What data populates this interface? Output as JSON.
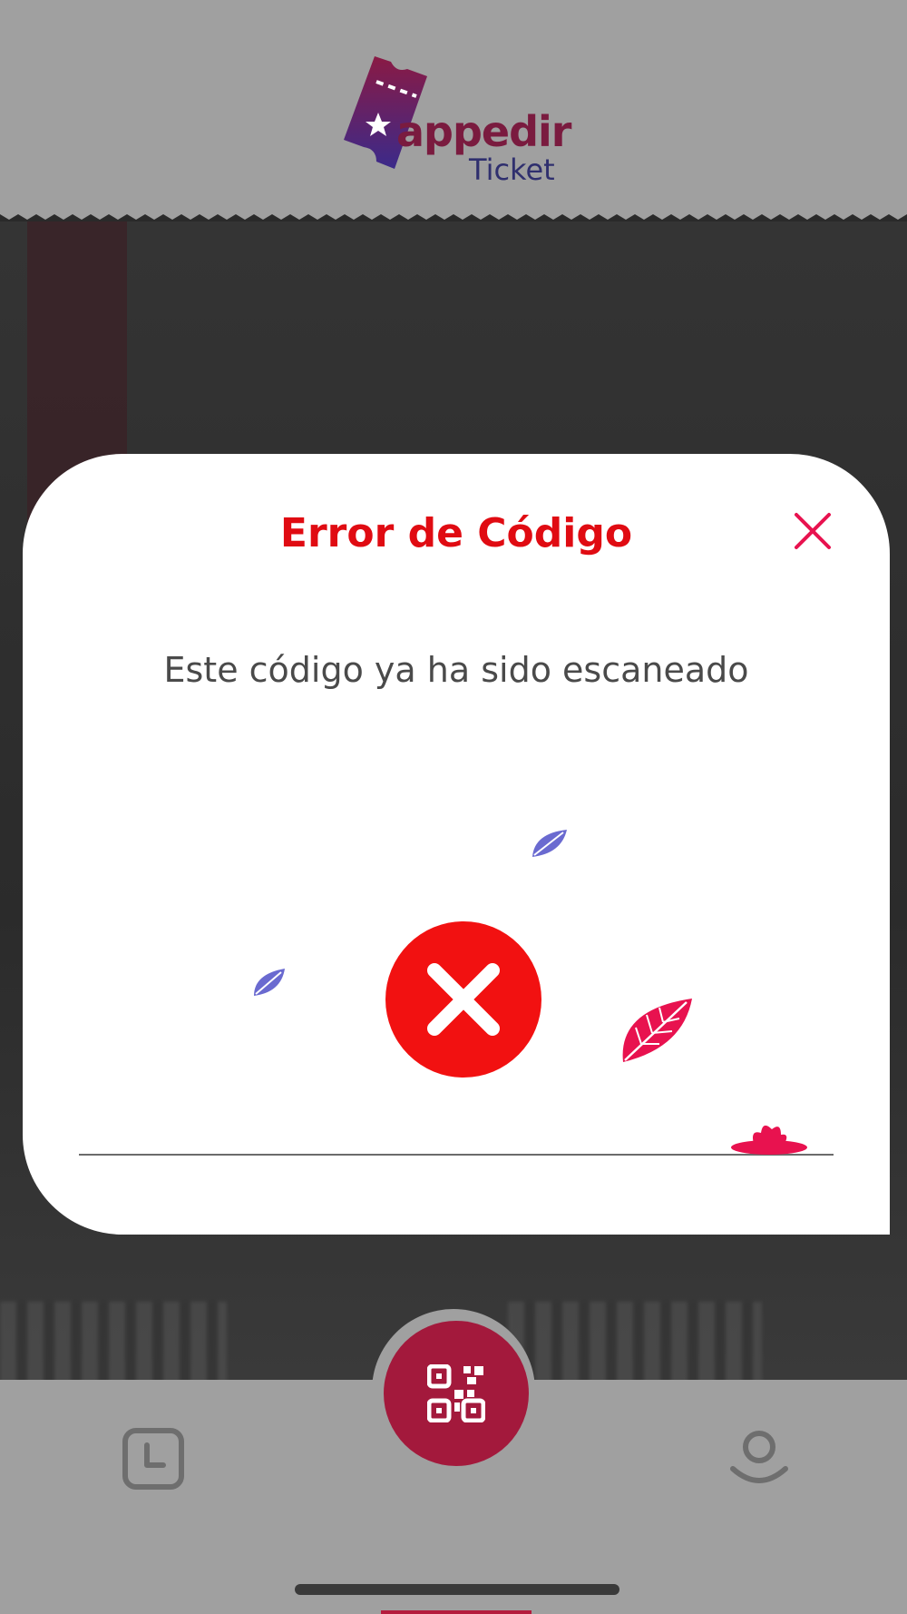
{
  "header": {
    "logo_word": "appedir",
    "logo_sub": "Ticket"
  },
  "modal": {
    "title": "Error de Código",
    "message": "Este código ya ha sido escaneado",
    "close_icon": "close-icon",
    "status_icon": "error-x-icon"
  },
  "nav": {
    "left_icon": "history-clock-icon",
    "center_icon": "qr-scan-icon",
    "right_icon": "profile-icon"
  },
  "colors": {
    "accent_red": "#e00b12",
    "brand": "#a3193c",
    "leaf_blue": "#6a6ad0",
    "leaf_pink": "#e8124f"
  }
}
